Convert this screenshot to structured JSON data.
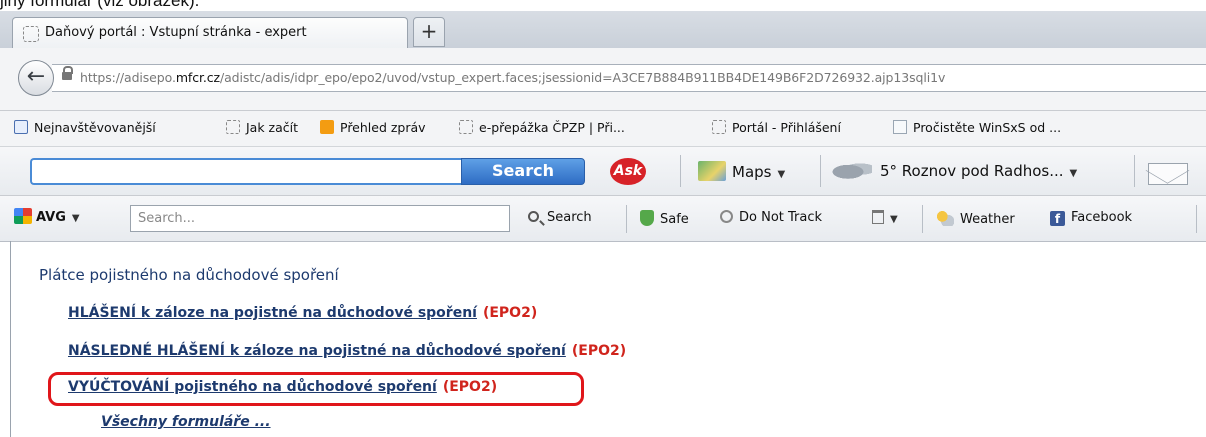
{
  "caption": "jiný formulář (viz obrázek).",
  "tab": {
    "title": "Daňový portál : Vstupní stránka - expert",
    "new_tab": "+"
  },
  "nav": {
    "back_icon": "back-arrow-icon",
    "url_prefix": "https://adisepo.",
    "url_domain": "mfcr.cz",
    "url_rest": "/adistc/adis/idpr_epo/epo2/uvod/vstup_expert.faces;jsessionid=A3CE7B884B911BB4DE149B6F2D726932.ajp13sqli1v"
  },
  "bookmarks": [
    {
      "label": "Nejnavštěvovanější",
      "icon": "search-icon"
    },
    {
      "label": "Jak začít",
      "icon": "page-icon"
    },
    {
      "label": "Přehled zpráv",
      "icon": "rss-icon"
    },
    {
      "label": "e-přepážka ČPZP | Při...",
      "icon": "page-icon"
    },
    {
      "label": "Portál - Přihlášení",
      "icon": "page-icon"
    },
    {
      "label": "Pročistěte WinSxS od ...",
      "icon": "doc-icon"
    }
  ],
  "ask_toolbar": {
    "search_button": "Search",
    "logo": "Ask",
    "maps": "Maps",
    "weather": "5° Roznov pod Radhos...",
    "mail_icon": "mail-icon"
  },
  "avg_toolbar": {
    "logo": "AVG",
    "search_placeholder": "Search...",
    "search": "Search",
    "safe": "Safe",
    "do_not_track": "Do Not Track",
    "weather": "Weather",
    "facebook": "Facebook"
  },
  "content": {
    "heading": "Plátce pojistného na důchodové spoření",
    "links": [
      {
        "text": "HLÁŠENÍ k záloze na pojistné na důchodové spoření",
        "tag": "(EPO2)"
      },
      {
        "text": "NÁSLEDNÉ HLÁŠENÍ k záloze na pojistné na důchodové spoření",
        "tag": "(EPO2)"
      },
      {
        "text": "VYÚČTOVÁNÍ pojistného na důchodové spoření",
        "tag": "(EPO2)"
      }
    ],
    "all_forms": "Všechny formuláře ..."
  },
  "colors": {
    "link": "#1d3a6e",
    "tag": "#d0241c",
    "highlight": "#e0161a"
  }
}
